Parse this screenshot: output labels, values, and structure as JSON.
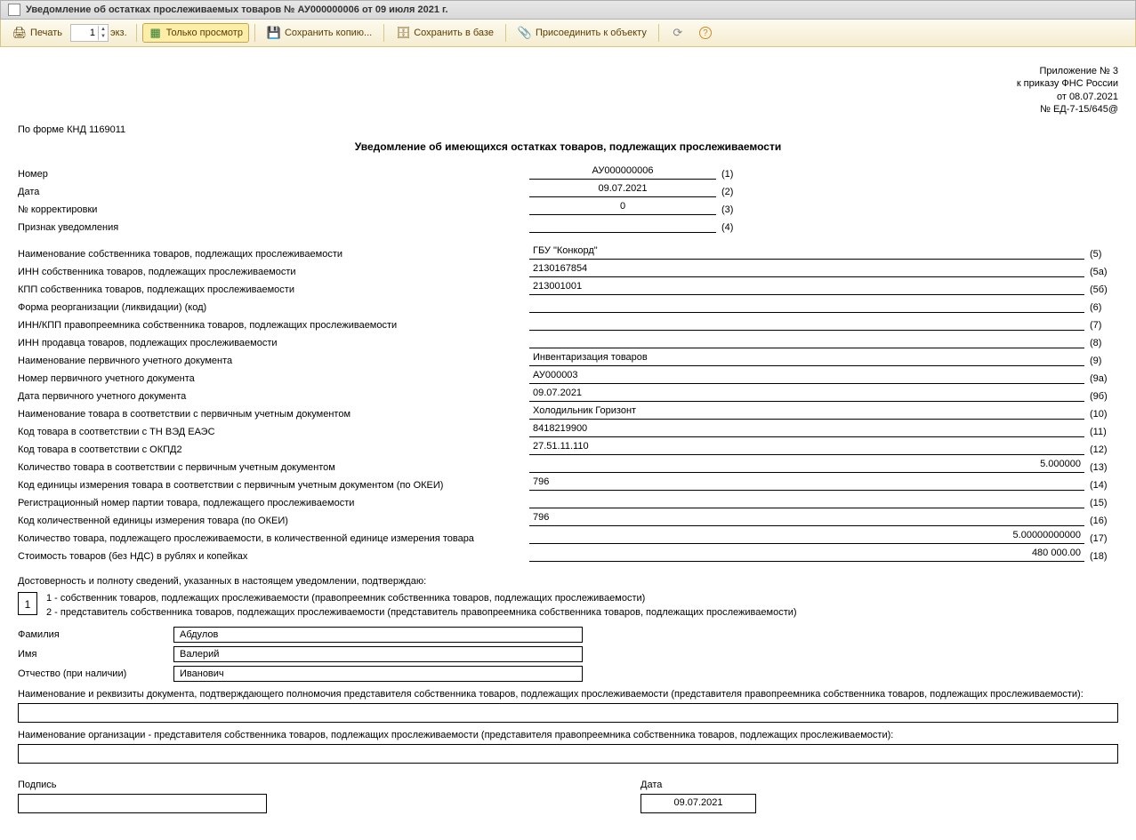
{
  "window": {
    "title": "Уведомление об остатках прослеживаемых товаров № АУ000000006 от 09 июля 2021 г."
  },
  "toolbar": {
    "print": "Печать",
    "copies_value": "1",
    "copies_suffix": "экз.",
    "view_only": "Только просмотр",
    "save_copy": "Сохранить копию...",
    "save_db": "Сохранить в базе",
    "attach": "Присоединить к объекту"
  },
  "annex": {
    "line1": "Приложение № 3",
    "line2": "к приказу ФНС России",
    "line3": "от 08.07.2021",
    "line4": "№ ЕД-7-15/645@"
  },
  "form_code": "По форме КНД 1169011",
  "title": "Уведомление об имеющихся остатках товаров, подлежащих прослеживаемости",
  "fields": [
    {
      "label": "Номер",
      "value": "АУ000000006",
      "num": "(1)",
      "type": "short",
      "align": "center"
    },
    {
      "label": "Дата",
      "value": "09.07.2021",
      "num": "(2)",
      "type": "short",
      "align": "center"
    },
    {
      "label": "№ корректировки",
      "value": "0",
      "num": "(3)",
      "type": "short",
      "align": "center"
    },
    {
      "label": "Признак уведомления",
      "value": "",
      "num": "(4)",
      "type": "short",
      "align": "center"
    },
    {
      "label": "Наименование собственника товаров, подлежащих прослеживаемости",
      "value": "ГБУ \"Конкорд\"",
      "num": "(5)",
      "type": "long"
    },
    {
      "label": "ИНН собственника товаров, подлежащих прослеживаемости",
      "value": "2130167854",
      "num": "(5а)",
      "type": "long"
    },
    {
      "label": "КПП собственника товаров, подлежащих прослеживаемости",
      "value": "213001001",
      "num": "(5б)",
      "type": "long"
    },
    {
      "label": "Форма реорганизации (ликвидации) (код)",
      "value": "",
      "num": "(6)",
      "type": "long"
    },
    {
      "label": "ИНН/КПП правопреемника собственника товаров, подлежащих прослеживаемости",
      "value": "",
      "num": "(7)",
      "type": "long"
    },
    {
      "label": "ИНН продавца товаров, подлежащих прослеживаемости",
      "value": "",
      "num": "(8)",
      "type": "long"
    },
    {
      "label": "Наименование первичного учетного документа",
      "value": "Инвентаризация товаров",
      "num": "(9)",
      "type": "long"
    },
    {
      "label": "Номер первичного учетного документа",
      "value": "АУ000003",
      "num": "(9а)",
      "type": "long"
    },
    {
      "label": "Дата первичного учетного документа",
      "value": "09.07.2021",
      "num": "(9б)",
      "type": "long"
    },
    {
      "label": "Наименование товара в соответствии с первичным учетным документом",
      "value": "Холодильник Горизонт",
      "num": "(10)",
      "type": "long"
    },
    {
      "label": "Код товара в соответствии с ТН ВЭД ЕАЭС",
      "value": "8418219900",
      "num": "(11)",
      "type": "long"
    },
    {
      "label": "Код товара в соответствии с ОКПД2",
      "value": "27.51.11.110",
      "num": "(12)",
      "type": "long"
    },
    {
      "label": "Количество товара в соответствии с первичным учетным документом",
      "value": "5.000000",
      "num": "(13)",
      "type": "long",
      "align": "right"
    },
    {
      "label": "Код единицы измерения товара в соответствии с первичным учетным документом (по ОКЕИ)",
      "value": "796",
      "num": "(14)",
      "type": "long"
    },
    {
      "label": "Регистрационный номер партии товара, подлежащего прослеживаемости",
      "value": "",
      "num": "(15)",
      "type": "long"
    },
    {
      "label": "Код количественной единицы измерения товара (по ОКЕИ)",
      "value": "796",
      "num": "(16)",
      "type": "long"
    },
    {
      "label": "Количество товара, подлежащего прослеживаемости, в количественной единице измерения товара",
      "value": "5.00000000000",
      "num": "(17)",
      "type": "long",
      "align": "right"
    },
    {
      "label": "Стоимость товаров (без НДС) в рублях и копейках",
      "value": "480 000.00",
      "num": "(18)",
      "type": "long",
      "align": "right"
    }
  ],
  "confirm": {
    "intro": "Достоверность и полноту сведений, указанных в настоящем уведомлении, подтверждаю:",
    "choice_value": "1",
    "choice1": "1 - собственник товаров, подлежащих прослеживаемости (правопреемник собственника товаров, подлежащих прослеживаемости)",
    "choice2": "2 - представитель собственника товаров, подлежащих прослеживаемости (представитель правопреемника собственника товаров, подлежащих прослеживаемости)"
  },
  "person": {
    "surname_label": "Фамилия",
    "surname": "Абдулов",
    "name_label": "Имя",
    "name": "Валерий",
    "patronymic_label": "Отчество (при наличии)",
    "patronymic": "Иванович"
  },
  "rep_doc": {
    "label": "Наименование и реквизиты документа, подтверждающего полномочия представителя собственника товаров, подлежащих прослеживаемости (представителя правопреемника собственника товаров, подлежащих прослеживаемости):",
    "value": ""
  },
  "rep_org": {
    "label": "Наименование организации - представителя собственника товаров, подлежащих прослеживаемости (представителя правопреемника собственника товаров, подлежащих прослеживаемости):",
    "value": ""
  },
  "signature": {
    "sign_label": "Подпись",
    "sign_value": "",
    "date_label": "Дата",
    "date_value": "09.07.2021"
  }
}
